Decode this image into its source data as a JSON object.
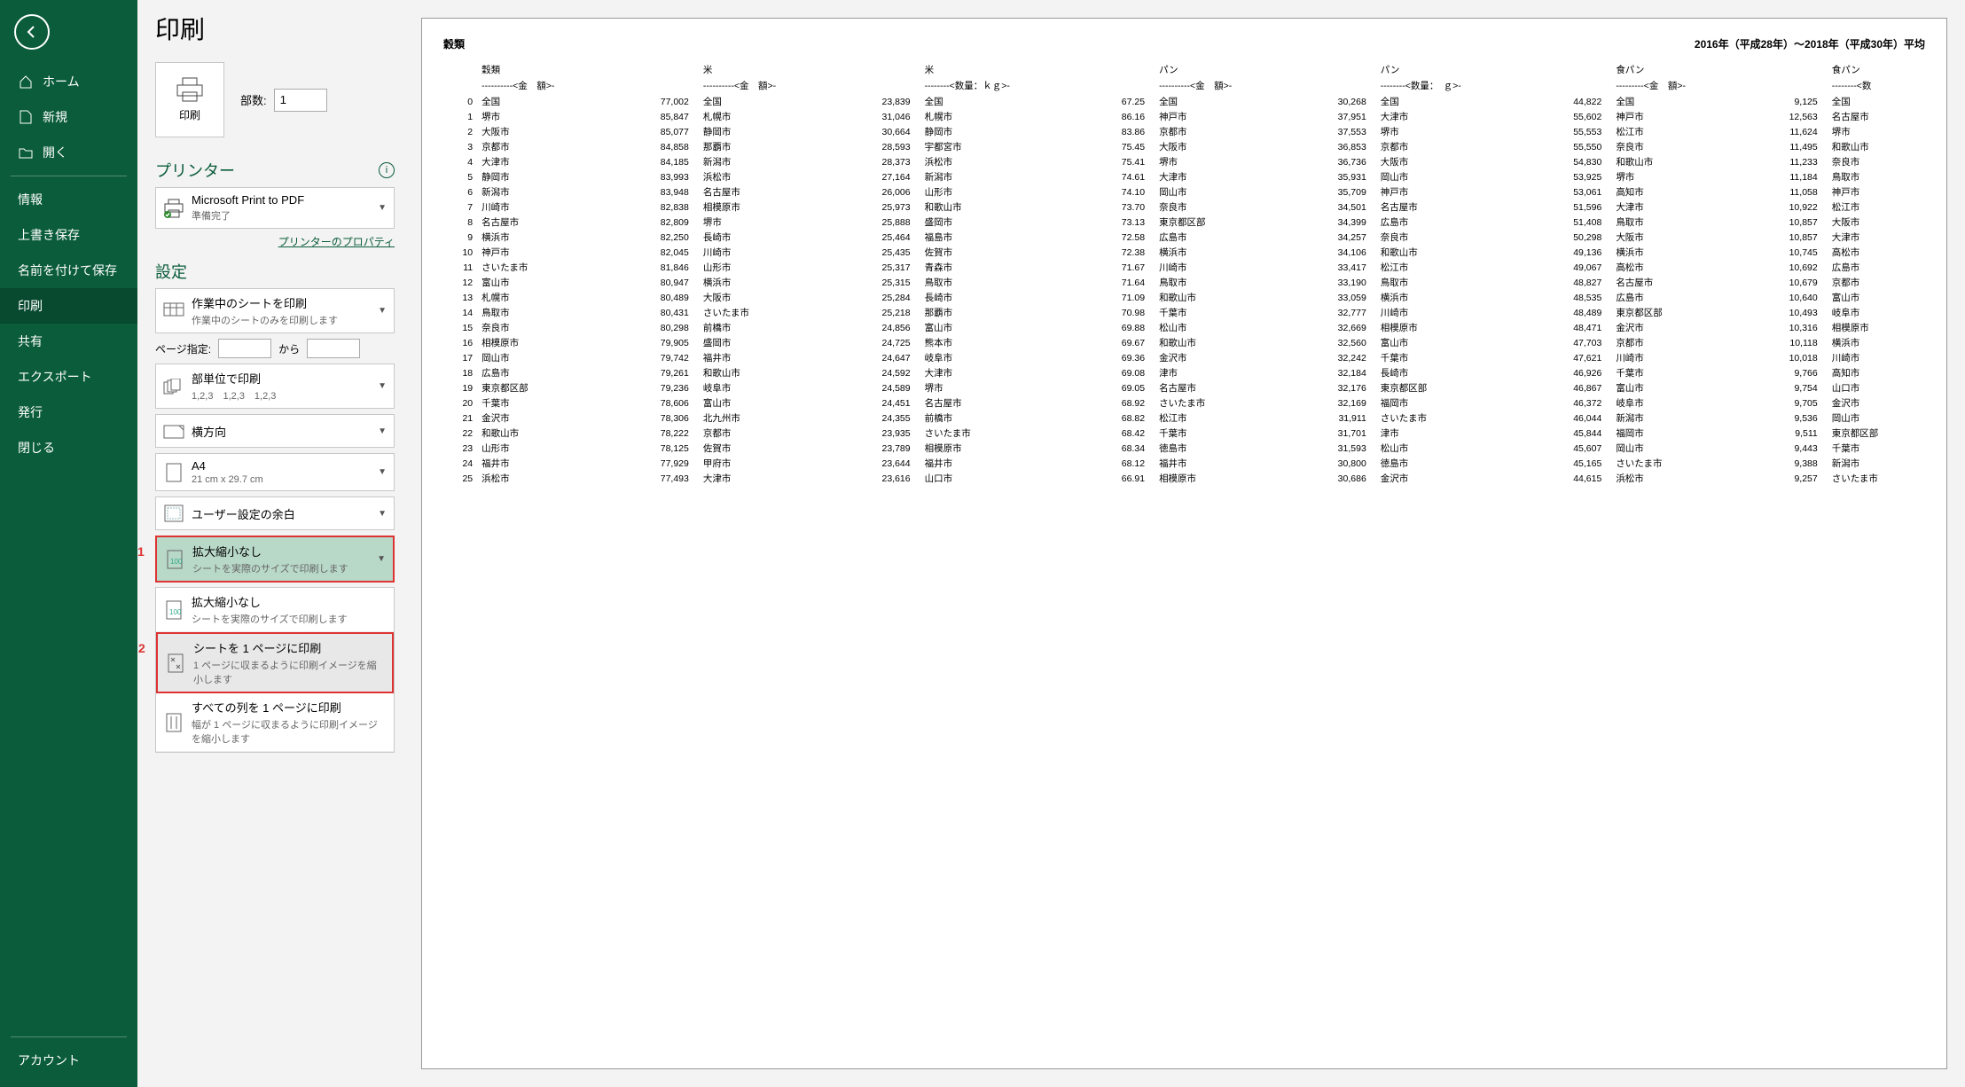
{
  "page_title": "印刷",
  "nav": {
    "home": "ホーム",
    "new": "新規",
    "open": "開く",
    "info": "情報",
    "save": "上書き保存",
    "saveas": "名前を付けて保存",
    "print": "印刷",
    "share": "共有",
    "export": "エクスポート",
    "publish": "発行",
    "close": "閉じる",
    "account": "アカウント"
  },
  "print_button": "印刷",
  "copies_label": "部数:",
  "copies_value": "1",
  "printer_section": "プリンター",
  "printer_name": "Microsoft Print to PDF",
  "printer_status": "準備完了",
  "printer_props": "プリンターのプロパティ",
  "settings_section": "設定",
  "print_what": {
    "title": "作業中のシートを印刷",
    "sub": "作業中のシートのみを印刷します"
  },
  "page_range_label": "ページ指定:",
  "page_range_to": "から",
  "collate": {
    "title": "部単位で印刷",
    "sub": "1,2,3　1,2,3　1,2,3"
  },
  "orientation": "横方向",
  "paper": {
    "title": "A4",
    "sub": "21 cm x 29.7 cm"
  },
  "margins": "ユーザー設定の余白",
  "scaling_current": {
    "title": "拡大縮小なし",
    "sub": "シートを実際のサイズで印刷します"
  },
  "annot1": "1",
  "annot2": "2",
  "scaling_opts": {
    "none": {
      "title": "拡大縮小なし",
      "sub": "シートを実際のサイズで印刷します"
    },
    "fit_sheet": {
      "title": "シートを 1 ページに印刷",
      "sub": "1 ページに収まるように印刷イメージを縮小します"
    },
    "fit_cols": {
      "title": "すべての列を 1 ページに印刷",
      "sub": "幅が 1 ページに収まるように印刷イメージを縮小します"
    }
  },
  "sheet": {
    "title_left": "穀類",
    "title_right": "2016年（平成28年）～2018年（平成30年）平均",
    "col_headers": [
      "",
      "穀類",
      "",
      "米",
      "",
      "米",
      "",
      "パン",
      "",
      "パン",
      "",
      "食パン",
      "",
      "食パン"
    ],
    "sub_headers": [
      "",
      "----------<金　額>-",
      "",
      "----------<金　額>-",
      "",
      "--------<数量：ｋｇ>-",
      "",
      "----------<金　額>-",
      "",
      "--------<数量：　ｇ>-",
      "",
      "---------<金　額>-",
      "",
      "--------<数"
    ],
    "rows": [
      [
        "0",
        "全国",
        "77,002",
        "全国",
        "23,839",
        "全国",
        "67.25",
        "全国",
        "30,268",
        "全国",
        "44,822",
        "全国",
        "9,125",
        "全国"
      ],
      [
        "1",
        "堺市",
        "85,847",
        "札幌市",
        "31,046",
        "札幌市",
        "86.16",
        "神戸市",
        "37,951",
        "大津市",
        "55,602",
        "神戸市",
        "12,563",
        "名古屋市"
      ],
      [
        "2",
        "大阪市",
        "85,077",
        "静岡市",
        "30,664",
        "静岡市",
        "83.86",
        "京都市",
        "37,553",
        "堺市",
        "55,553",
        "松江市",
        "11,624",
        "堺市"
      ],
      [
        "3",
        "京都市",
        "84,858",
        "那覇市",
        "28,593",
        "宇都宮市",
        "75.45",
        "大阪市",
        "36,853",
        "京都市",
        "55,550",
        "奈良市",
        "11,495",
        "和歌山市"
      ],
      [
        "4",
        "大津市",
        "84,185",
        "新潟市",
        "28,373",
        "浜松市",
        "75.41",
        "堺市",
        "36,736",
        "大阪市",
        "54,830",
        "和歌山市",
        "11,233",
        "奈良市"
      ],
      [
        "5",
        "静岡市",
        "83,993",
        "浜松市",
        "27,164",
        "新潟市",
        "74.61",
        "大津市",
        "35,931",
        "岡山市",
        "53,925",
        "堺市",
        "11,184",
        "鳥取市"
      ],
      [
        "6",
        "新潟市",
        "83,948",
        "名古屋市",
        "26,006",
        "山形市",
        "74.10",
        "岡山市",
        "35,709",
        "神戸市",
        "53,061",
        "高知市",
        "11,058",
        "神戸市"
      ],
      [
        "7",
        "川崎市",
        "82,838",
        "相模原市",
        "25,973",
        "和歌山市",
        "73.70",
        "奈良市",
        "34,501",
        "名古屋市",
        "51,596",
        "大津市",
        "10,922",
        "松江市"
      ],
      [
        "8",
        "名古屋市",
        "82,809",
        "堺市",
        "25,888",
        "盛岡市",
        "73.13",
        "東京都区部",
        "34,399",
        "広島市",
        "51,408",
        "鳥取市",
        "10,857",
        "大阪市"
      ],
      [
        "9",
        "横浜市",
        "82,250",
        "長崎市",
        "25,464",
        "福島市",
        "72.58",
        "広島市",
        "34,257",
        "奈良市",
        "50,298",
        "大阪市",
        "10,857",
        "大津市"
      ],
      [
        "10",
        "神戸市",
        "82,045",
        "川崎市",
        "25,435",
        "佐賀市",
        "72.38",
        "横浜市",
        "34,106",
        "和歌山市",
        "49,136",
        "横浜市",
        "10,745",
        "高松市"
      ],
      [
        "11",
        "さいたま市",
        "81,846",
        "山形市",
        "25,317",
        "青森市",
        "71.67",
        "川崎市",
        "33,417",
        "松江市",
        "49,067",
        "高松市",
        "10,692",
        "広島市"
      ],
      [
        "12",
        "富山市",
        "80,947",
        "横浜市",
        "25,315",
        "鳥取市",
        "71.64",
        "鳥取市",
        "33,190",
        "鳥取市",
        "48,827",
        "名古屋市",
        "10,679",
        "京都市"
      ],
      [
        "13",
        "札幌市",
        "80,489",
        "大阪市",
        "25,284",
        "長崎市",
        "71.09",
        "和歌山市",
        "33,059",
        "横浜市",
        "48,535",
        "広島市",
        "10,640",
        "富山市"
      ],
      [
        "14",
        "鳥取市",
        "80,431",
        "さいたま市",
        "25,218",
        "那覇市",
        "70.98",
        "千葉市",
        "32,777",
        "川崎市",
        "48,489",
        "東京都区部",
        "10,493",
        "岐阜市"
      ],
      [
        "15",
        "奈良市",
        "80,298",
        "前橋市",
        "24,856",
        "富山市",
        "69.88",
        "松山市",
        "32,669",
        "相模原市",
        "48,471",
        "金沢市",
        "10,316",
        "相模原市"
      ],
      [
        "16",
        "相模原市",
        "79,905",
        "盛岡市",
        "24,725",
        "熊本市",
        "69.67",
        "和歌山市",
        "32,560",
        "富山市",
        "47,703",
        "京都市",
        "10,118",
        "横浜市"
      ],
      [
        "17",
        "岡山市",
        "79,742",
        "福井市",
        "24,647",
        "岐阜市",
        "69.36",
        "金沢市",
        "32,242",
        "千葉市",
        "47,621",
        "川崎市",
        "10,018",
        "川崎市"
      ],
      [
        "18",
        "広島市",
        "79,261",
        "和歌山市",
        "24,592",
        "大津市",
        "69.08",
        "津市",
        "32,184",
        "長崎市",
        "46,926",
        "千葉市",
        "9,766",
        "高知市"
      ],
      [
        "19",
        "東京都区部",
        "79,236",
        "岐阜市",
        "24,589",
        "堺市",
        "69.05",
        "名古屋市",
        "32,176",
        "東京都区部",
        "46,867",
        "富山市",
        "9,754",
        "山口市"
      ],
      [
        "20",
        "千葉市",
        "78,606",
        "富山市",
        "24,451",
        "名古屋市",
        "68.92",
        "さいたま市",
        "32,169",
        "福岡市",
        "46,372",
        "岐阜市",
        "9,705",
        "金沢市"
      ],
      [
        "21",
        "金沢市",
        "78,306",
        "北九州市",
        "24,355",
        "前橋市",
        "68.82",
        "松江市",
        "31,911",
        "さいたま市",
        "46,044",
        "新潟市",
        "9,536",
        "岡山市"
      ],
      [
        "22",
        "和歌山市",
        "78,222",
        "京都市",
        "23,935",
        "さいたま市",
        "68.42",
        "千葉市",
        "31,701",
        "津市",
        "45,844",
        "福岡市",
        "9,511",
        "東京都区部"
      ],
      [
        "23",
        "山形市",
        "78,125",
        "佐賀市",
        "23,789",
        "相模原市",
        "68.34",
        "徳島市",
        "31,593",
        "松山市",
        "45,607",
        "岡山市",
        "9,443",
        "千葉市"
      ],
      [
        "24",
        "福井市",
        "77,929",
        "甲府市",
        "23,644",
        "福井市",
        "68.12",
        "福井市",
        "30,800",
        "徳島市",
        "45,165",
        "さいたま市",
        "9,388",
        "新潟市"
      ],
      [
        "25",
        "浜松市",
        "77,493",
        "大津市",
        "23,616",
        "山口市",
        "66.91",
        "相模原市",
        "30,686",
        "金沢市",
        "44,615",
        "浜松市",
        "9,257",
        "さいたま市"
      ]
    ]
  }
}
